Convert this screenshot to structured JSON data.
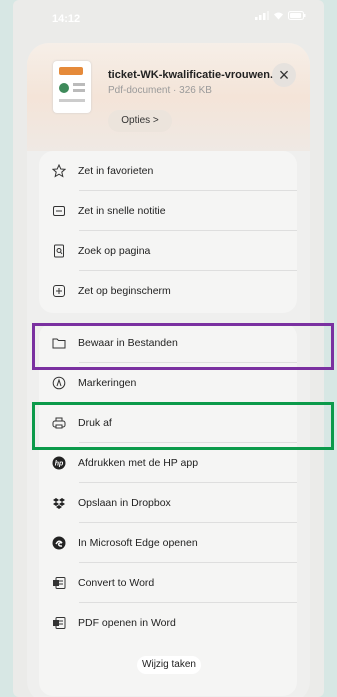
{
  "status_bar": {
    "time": "14:12"
  },
  "file": {
    "name": "ticket-WK-kwalificatie-vrouwen...",
    "meta": "Pdf-document · 326 KB",
    "options_label": "Opties >"
  },
  "group1": [
    {
      "label": "Zet in favorieten",
      "icon": "star-icon"
    },
    {
      "label": "Zet in snelle notitie",
      "icon": "quick-note-icon"
    },
    {
      "label": "Zoek op pagina",
      "icon": "find-on-page-icon"
    },
    {
      "label": "Zet op beginscherm",
      "icon": "add-to-home-icon"
    }
  ],
  "group2": [
    {
      "label": "Bewaar in Bestanden",
      "icon": "folder-icon"
    },
    {
      "label": "Markeringen",
      "icon": "markup-icon"
    },
    {
      "label": "Druk af",
      "icon": "printer-icon"
    },
    {
      "label": "Afdrukken met de HP app",
      "icon": "hp-icon"
    },
    {
      "label": "Opslaan in Dropbox",
      "icon": "dropbox-icon"
    },
    {
      "label": "In Microsoft Edge openen",
      "icon": "edge-icon"
    },
    {
      "label": "Convert to Word",
      "icon": "word-icon"
    },
    {
      "label": "PDF openen in Word",
      "icon": "word-icon"
    }
  ],
  "footer": {
    "edit_actions_label": "Wijzig taken"
  },
  "highlights": {
    "purple": "#7a30a0",
    "green": "#0b9a4a"
  }
}
